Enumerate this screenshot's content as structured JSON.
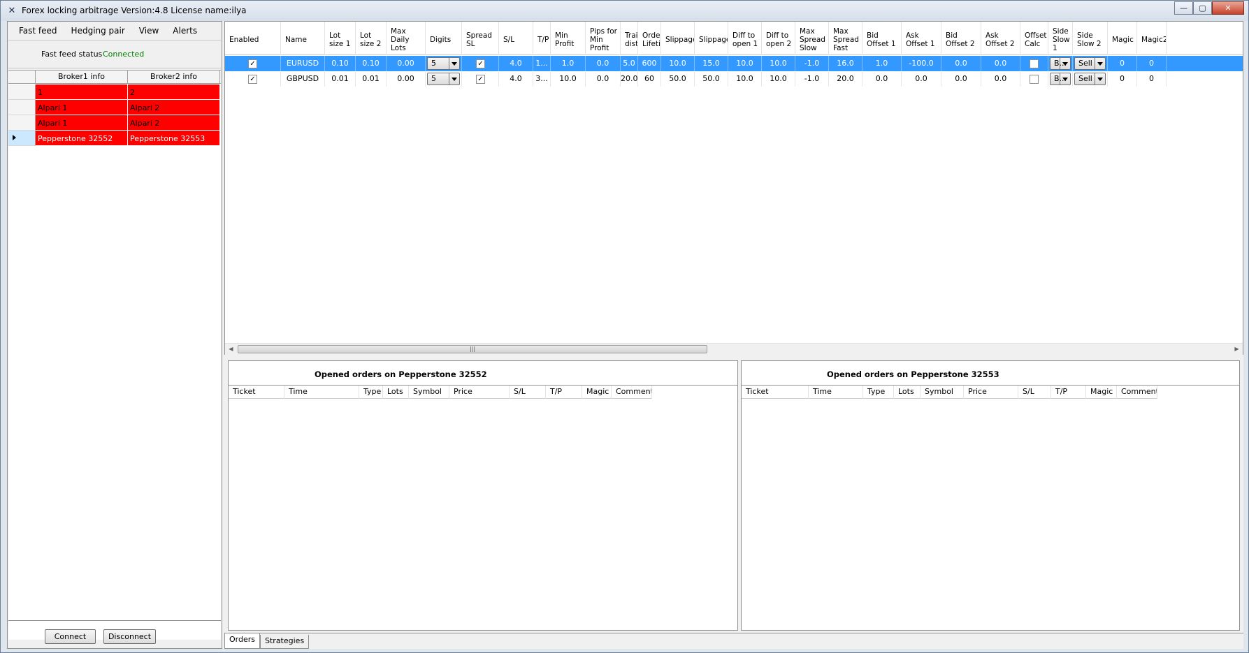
{
  "window": {
    "title": "Forex locking arbitrage  Version:4.8 License name:ilya",
    "controls": {
      "minimize": "—",
      "restore": "▢",
      "close": "✕"
    }
  },
  "menu": {
    "items": [
      "Fast feed",
      "Hedging pair",
      "View",
      "Alerts"
    ]
  },
  "status": {
    "label": "Fast feed status",
    "value": "Connected",
    "value_color": "#008000"
  },
  "broker_grid": {
    "columns": [
      "Broker1 info",
      "Broker2 info"
    ],
    "rows": [
      {
        "broker1": "1",
        "broker2": "2"
      },
      {
        "broker1": "Alpari 1",
        "broker2": "Alpari 2"
      },
      {
        "broker1": "Alpari 1",
        "broker2": "Alpari 2"
      },
      {
        "broker1": "Pepperstone 32552",
        "broker2": "Pepperstone 32553",
        "current": true
      }
    ],
    "row_color": "#ff0000"
  },
  "buttons": {
    "connect": "Connect",
    "disconnect": "Disconnect"
  },
  "strategies": {
    "columns": [
      "Enabled",
      "Name",
      "Lot size 1",
      "Lot size 2",
      "Max Daily Lots",
      "Digits",
      "Spread SL",
      "S/L",
      "T/P",
      "Min Profit",
      "Pips for Min Profit",
      "Trail dista",
      "Order Lifetim",
      "Slippage",
      "Slippage",
      "Diff to open 1",
      "Diff to open 2",
      "Max Spread Slow",
      "Max Spread Fast",
      "Bid Offset 1",
      "Ask Offset 1",
      "Bid Offset 2",
      "Ask Offset 2",
      "Offset Calc",
      "Side Slow 1",
      "Side Slow 2",
      "Magic",
      "Magic2"
    ],
    "rows": [
      {
        "enabled": true,
        "name": "EURUSD",
        "lot1": "0.10",
        "lot2": "0.10",
        "max_daily": "0.00",
        "digits": "5",
        "spread_sl": true,
        "sl": "4.0",
        "tp": "1...",
        "min_profit": "1.0",
        "pips_min_profit": "0.0",
        "trail": "5.0",
        "lifetime": "600",
        "slip1": "10.0",
        "slip2": "15.0",
        "diff1": "10.0",
        "diff2": "10.0",
        "max_slow": "-1.0",
        "max_fast": "16.0",
        "bid1": "1.0",
        "ask1": "-100.0",
        "bid2": "0.0",
        "ask2": "0.0",
        "offset_calc": false,
        "side1": "B...",
        "side2": "Sell",
        "magic": "0",
        "magic2": "0",
        "selected": true
      },
      {
        "enabled": true,
        "name": "GBPUSD",
        "lot1": "0.01",
        "lot2": "0.01",
        "max_daily": "0.00",
        "digits": "5",
        "spread_sl": true,
        "sl": "4.0",
        "tp": "3...",
        "min_profit": "10.0",
        "pips_min_profit": "0.0",
        "trail": "20.0",
        "lifetime": "60",
        "slip1": "50.0",
        "slip2": "50.0",
        "diff1": "10.0",
        "diff2": "10.0",
        "max_slow": "-1.0",
        "max_fast": "20.0",
        "bid1": "0.0",
        "ask1": "0.0",
        "bid2": "0.0",
        "ask2": "0.0",
        "offset_calc": false,
        "side1": "B...",
        "side2": "Sell",
        "magic": "0",
        "magic2": "0",
        "selected": false
      }
    ],
    "selection_color": "#3399ff"
  },
  "orders": {
    "left_title": "Opened orders on Pepperstone 32552",
    "right_title": "Opened orders on Pepperstone 32553",
    "columns": [
      "Ticket",
      "Time",
      "Type",
      "Lots",
      "Symbol",
      "Price",
      "S/L",
      "T/P",
      "Magic",
      "Comment"
    ]
  },
  "tabs": [
    "Orders",
    "Strategies"
  ]
}
